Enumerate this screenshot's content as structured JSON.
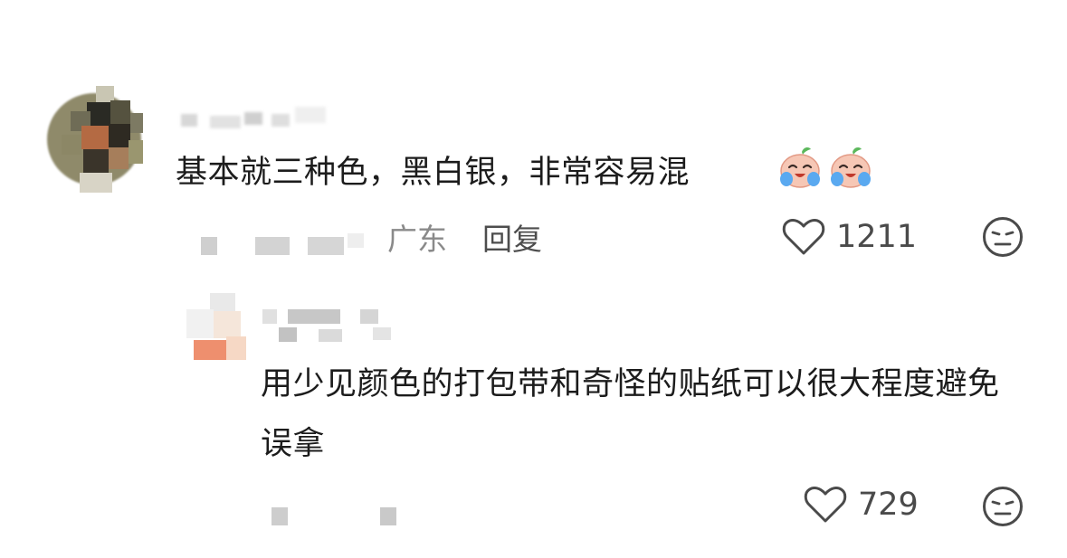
{
  "comment": {
    "text": "基本就三种色，黑白银，非常容易混",
    "emojis": [
      "crying-peach-icon",
      "crying-peach-icon"
    ],
    "location": "广东",
    "reply_label": "回复",
    "like_count": "1211",
    "icons": {
      "like": "heart-outline-icon",
      "dislike": "meh-face-icon"
    }
  },
  "reply": {
    "text": "用少见颜色的打包带和奇怪的贴纸可以很大程度避免误拿",
    "like_count": "729",
    "icons": {
      "like": "heart-outline-icon",
      "dislike": "meh-face-icon"
    }
  },
  "colors": {
    "text": "#1c1c1c",
    "meta": "#8a8a8a",
    "icon_stroke": "#4a4a4a",
    "emoji_skin": "#f6c7b5",
    "emoji_tear": "#5aa9f0",
    "emoji_leaf": "#5cb85c"
  }
}
